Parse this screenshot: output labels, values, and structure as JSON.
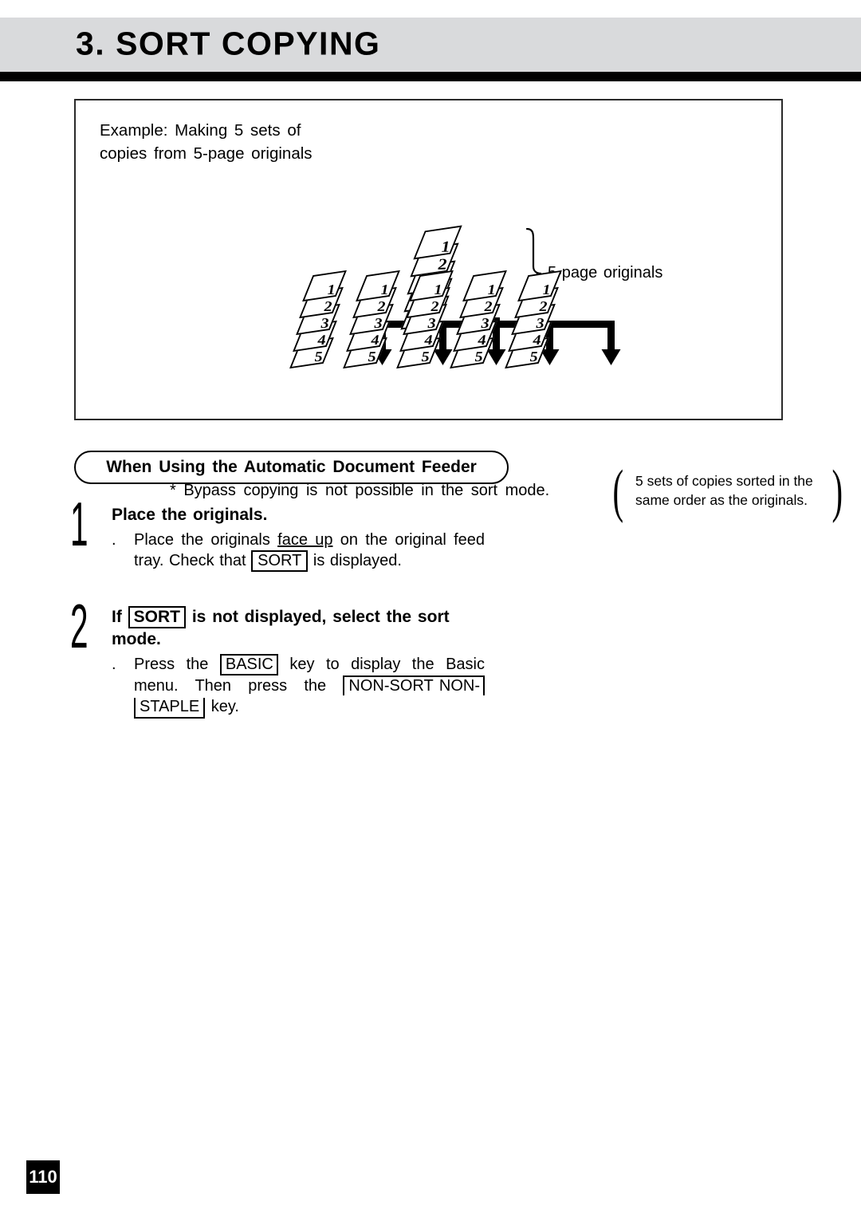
{
  "header": {
    "chapter_title": "3. SORT COPYING"
  },
  "diagram": {
    "example_caption": "Example: Making 5 sets of\ncopies from 5-page originals",
    "originals_label": "5-page originals",
    "originals_pages": [
      "1",
      "2",
      "3",
      "4",
      "5"
    ],
    "copy_sets": [
      {
        "pages": [
          "1",
          "2",
          "3",
          "4",
          "5"
        ]
      },
      {
        "pages": [
          "1",
          "2",
          "3",
          "4",
          "5"
        ]
      },
      {
        "pages": [
          "1",
          "2",
          "3",
          "4",
          "5"
        ]
      },
      {
        "pages": [
          "1",
          "2",
          "3",
          "4",
          "5"
        ]
      },
      {
        "pages": [
          "1",
          "2",
          "3",
          "4",
          "5"
        ]
      }
    ],
    "bypass_note": "* Bypass copying is not possible in the sort mode.",
    "sorted_note": "5 sets of copies sorted in the\nsame order as the originals.",
    "paren_left": "(",
    "paren_right": ")"
  },
  "section": {
    "adf_label": "When Using the Automatic Document Feeder"
  },
  "steps": [
    {
      "number": "1",
      "title": "Place the originals.",
      "bullet": ".",
      "detail_part_1": "Place the originals ",
      "detail_underlined": "face up",
      "detail_part_2": " on the original feed tray.  Check that ",
      "key_1": "SORT",
      "detail_part_3": " is displayed."
    },
    {
      "number": "2",
      "title_part_1": "If ",
      "title_key": "SORT",
      "title_part_2": " is not displayed, select the sort mode.",
      "bullet": ".",
      "detail_part_1": "Press the ",
      "key_1": "BASIC",
      "detail_part_2": " key to display the Basic menu. Then press the ",
      "key_2_line_1": "NON-SORT NON-",
      "key_2_line_2": "STAPLE",
      "detail_part_3": " key."
    }
  ],
  "footer": {
    "page_number": "110"
  }
}
